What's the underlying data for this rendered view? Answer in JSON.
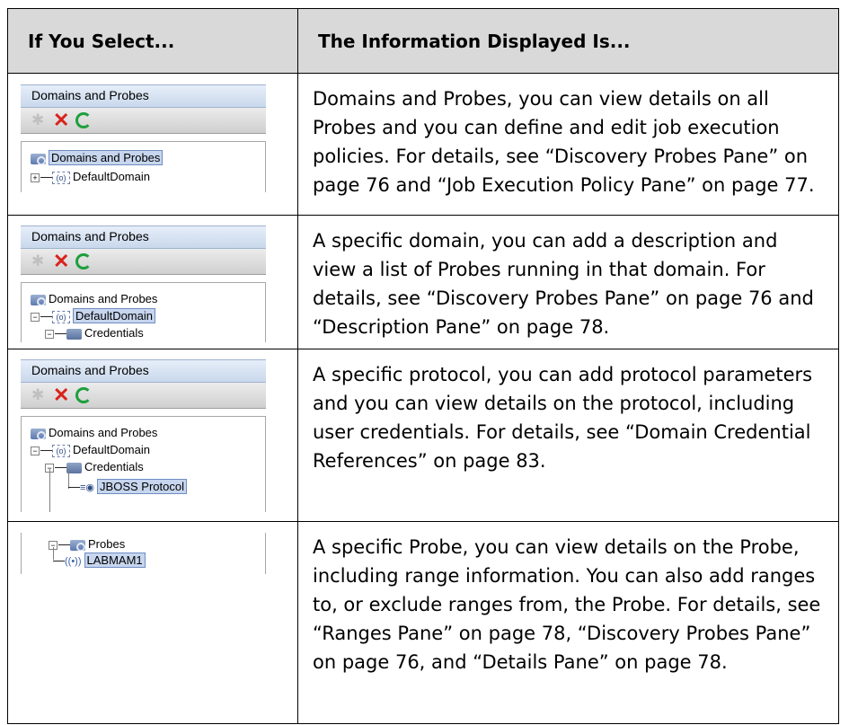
{
  "header": {
    "col1": "If You Select...",
    "col2": "The Information Displayed Is..."
  },
  "rows": [
    {
      "screenshot": {
        "pane_title": "Domains and Probes",
        "tree": [
          "Domains and Probes",
          "DefaultDomain"
        ],
        "selected": "Domains and Probes"
      },
      "description": "Domains and Probes, you can view details on all Probes and you can define and edit job execution policies. For details, see “Discovery Probes Pane” on page 76 and “Job Execution Policy Pane” on page 77."
    },
    {
      "screenshot": {
        "pane_title": "Domains and Probes",
        "tree": [
          "Domains and Probes",
          "DefaultDomain",
          "Credentials"
        ],
        "selected": "DefaultDomain"
      },
      "description": "A specific domain, you can add a description and view a list of Probes running in that domain. For details, see “Discovery Probes Pane” on page 76 and “Description Pane” on page 78."
    },
    {
      "screenshot": {
        "pane_title": "Domains and Probes",
        "tree": [
          "Domains and Probes",
          "DefaultDomain",
          "Credentials",
          "JBOSS Protocol"
        ],
        "selected": "JBOSS Protocol"
      },
      "description": "A specific protocol, you can add protocol parameters and you can view details on the protocol, including user credentials. For details, see “Domain Credential References” on page 83."
    },
    {
      "screenshot": {
        "tree": [
          "Probes",
          "LABMAM1"
        ],
        "selected": "LABMAM1"
      },
      "description": "A specific Probe, you can view details on the Probe, including range information. You can also add ranges to, or exclude ranges from, the Probe. For details, see “Ranges Pane” on page 78, “Discovery Probes Pane” on page 76, and “Details Pane” on page 78."
    }
  ],
  "icons": {
    "toolbar": [
      "new-icon",
      "delete-icon",
      "refresh-icon"
    ],
    "tree": [
      "domains-folder-icon",
      "domain-icon",
      "credentials-icon",
      "protocol-icon",
      "probe-icon"
    ]
  },
  "colors": {
    "header_bg": "#d9d9d9",
    "selection_bg": "#c7d6ee",
    "delete_red": "#d8231b",
    "refresh_green": "#1e9f3c"
  }
}
